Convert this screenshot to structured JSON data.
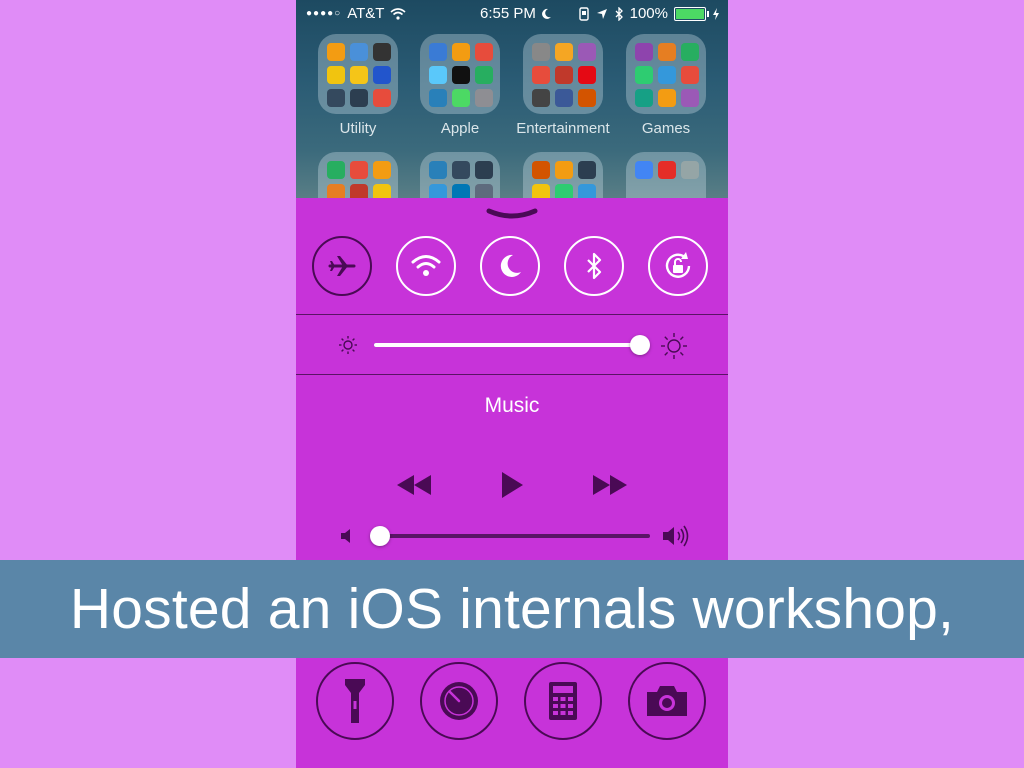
{
  "status_bar": {
    "carrier": "AT&T",
    "time": "6:55 PM",
    "battery_percent": "100%"
  },
  "home_screen": {
    "folders": [
      {
        "label": "Utility",
        "icons": [
          "#f39c12",
          "#4a90d9",
          "#333",
          "#f1c40f",
          "#f5c518",
          "#2255cc",
          "#34495e",
          "#2c3e50",
          "#e74c3c"
        ]
      },
      {
        "label": "Apple",
        "icons": [
          "#3a7bd5",
          "#f39c12",
          "#e74c3c",
          "#5ac8fa",
          "#111",
          "#27ae60",
          "#2980b9",
          "#4cd964",
          "#8e8e93"
        ]
      },
      {
        "label": "Entertainment",
        "icons": [
          "#888",
          "#f5a623",
          "#9b59b6",
          "#e74c3c",
          "#c0392b",
          "#e50914",
          "#444",
          "#3b5998",
          "#d35400"
        ]
      },
      {
        "label": "Games",
        "icons": [
          "#8e44ad",
          "#e67e22",
          "#27ae60",
          "#2ecc71",
          "#3498db",
          "#e74c3c",
          "#16a085",
          "#f39c12",
          "#9b59b6"
        ]
      }
    ],
    "second_row_folders": [
      {
        "icons": [
          "#27ae60",
          "#e74c3c",
          "#f39c12",
          "#e67e22",
          "#c0392b",
          "#f1c40f"
        ]
      },
      {
        "icons": [
          "#2980b9",
          "#34495e",
          "#2c3e50",
          "#3498db",
          "#0077b5",
          "#5e6b7d"
        ]
      },
      {
        "icons": [
          "#d35400",
          "#f39c12",
          "#2c3e50",
          "#f1c40f",
          "#2ecc71",
          "#3498db"
        ]
      },
      {
        "icons": [
          "#4285f4",
          "#e52d27",
          "#95a5a6"
        ]
      }
    ]
  },
  "control_center": {
    "toggles": [
      {
        "name": "airplane-mode",
        "icon": "airplane-icon",
        "active": true
      },
      {
        "name": "wifi",
        "icon": "wifi-icon",
        "active": false
      },
      {
        "name": "do-not-disturb",
        "icon": "moon-icon",
        "active": false
      },
      {
        "name": "bluetooth",
        "icon": "bluetooth-icon",
        "active": false
      },
      {
        "name": "rotation-lock",
        "icon": "rotation-lock-icon",
        "active": false
      }
    ],
    "brightness_level": 1.0,
    "music": {
      "title": "Music",
      "volume_level": 0.0
    },
    "shortcuts": [
      "flashlight-icon",
      "timer-icon",
      "calculator-icon",
      "camera-icon"
    ]
  },
  "banner": {
    "text": "Hosted an iOS internals workshop,"
  },
  "colors": {
    "page_background": "#e08cf7",
    "control_center": "#c733d9",
    "dark_glyph": "#4a0a55",
    "banner": "#5a86a8"
  }
}
